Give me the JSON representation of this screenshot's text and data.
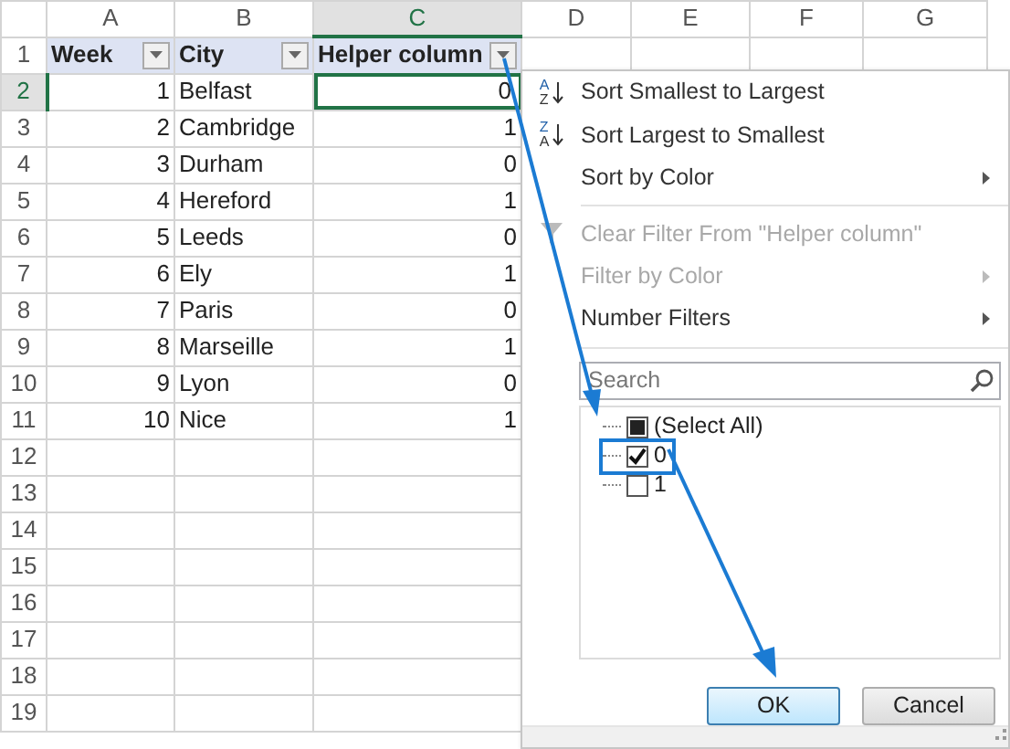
{
  "columns": [
    {
      "label": "A",
      "selected": false
    },
    {
      "label": "B",
      "selected": false
    },
    {
      "label": "C",
      "selected": true
    },
    {
      "label": "D",
      "selected": false
    },
    {
      "label": "E",
      "selected": false
    },
    {
      "label": "F",
      "selected": false
    },
    {
      "label": "G",
      "selected": false
    }
  ],
  "header_row": {
    "number": "1",
    "cells": [
      "Week",
      "City",
      "Helper column"
    ]
  },
  "data_rows": [
    {
      "number": "2",
      "selected": true,
      "week": "1",
      "city": "Belfast",
      "helper": "0"
    },
    {
      "number": "3",
      "selected": false,
      "week": "2",
      "city": "Cambridge",
      "helper": "1"
    },
    {
      "number": "4",
      "selected": false,
      "week": "3",
      "city": "Durham",
      "helper": "0"
    },
    {
      "number": "5",
      "selected": false,
      "week": "4",
      "city": "Hereford",
      "helper": "1"
    },
    {
      "number": "6",
      "selected": false,
      "week": "5",
      "city": "Leeds",
      "helper": "0"
    },
    {
      "number": "7",
      "selected": false,
      "week": "6",
      "city": "Ely",
      "helper": "1"
    },
    {
      "number": "8",
      "selected": false,
      "week": "7",
      "city": "Paris",
      "helper": "0"
    },
    {
      "number": "9",
      "selected": false,
      "week": "8",
      "city": "Marseille",
      "helper": "1"
    },
    {
      "number": "10",
      "selected": false,
      "week": "9",
      "city": "Lyon",
      "helper": "0"
    },
    {
      "number": "11",
      "selected": false,
      "week": "10",
      "city": "Nice",
      "helper": "1"
    }
  ],
  "empty_rows": [
    "12",
    "13",
    "14",
    "15",
    "16",
    "17",
    "18",
    "19"
  ],
  "filter_menu": {
    "items": [
      {
        "label": "Sort Smallest to Largest",
        "kind": "sort-ascending",
        "icon_letters": [
          "A",
          "Z"
        ],
        "disabled": false,
        "submenu": false,
        "separator_after": false
      },
      {
        "label": "Sort Largest to Smallest",
        "kind": "sort-descending",
        "icon_letters": [
          "Z",
          "A"
        ],
        "disabled": false,
        "submenu": false,
        "separator_after": false
      },
      {
        "label": "Sort by Color",
        "kind": "plain",
        "disabled": false,
        "submenu": true,
        "separator_after": true
      },
      {
        "label": "Clear Filter From \"Helper column\"",
        "kind": "clear-filter",
        "disabled": true,
        "submenu": false,
        "separator_after": false
      },
      {
        "label": "Filter by Color",
        "kind": "plain",
        "disabled": true,
        "submenu": true,
        "separator_after": false
      },
      {
        "label": "Number Filters",
        "kind": "plain",
        "disabled": false,
        "submenu": true,
        "separator_after": true
      }
    ],
    "search": {
      "placeholder": "Search"
    },
    "values": [
      {
        "label": "(Select All)",
        "checked": false,
        "indeterminate": true,
        "highlighted": false
      },
      {
        "label": "0",
        "checked": true,
        "indeterminate": false,
        "highlighted": true
      },
      {
        "label": "1",
        "checked": false,
        "indeterminate": false,
        "highlighted": false
      }
    ],
    "buttons": [
      {
        "label": "OK",
        "default": true
      },
      {
        "label": "Cancel",
        "default": false
      }
    ]
  }
}
